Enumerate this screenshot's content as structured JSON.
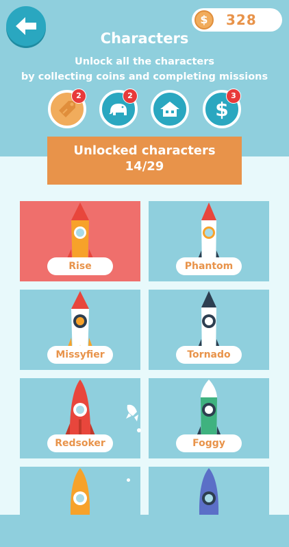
{
  "header": {
    "coins": "328",
    "coin_symbol": "$",
    "title": "Characters",
    "subtitle_line1": "Unlock all the characters",
    "subtitle_line2": "by collecting coins and completing missions"
  },
  "missions": [
    {
      "icon": "tag-icon",
      "badge": "2",
      "color": "#f1ac5c"
    },
    {
      "icon": "elephant-icon",
      "badge": "2",
      "color": "#2aa7c0"
    },
    {
      "icon": "house-icon",
      "badge": "",
      "color": "#2aa7c0"
    },
    {
      "icon": "dollar-icon",
      "badge": "3",
      "color": "#2aa7c0"
    }
  ],
  "unlocked": {
    "label": "Unlocked characters",
    "count": "14/29"
  },
  "characters": [
    {
      "name": "Rise",
      "selected": true
    },
    {
      "name": "Phantom",
      "selected": false
    },
    {
      "name": "Missyfier",
      "selected": false
    },
    {
      "name": "Tornado",
      "selected": false
    },
    {
      "name": "Redsoker",
      "selected": false
    },
    {
      "name": "Foggy",
      "selected": false
    }
  ],
  "colors": {
    "sky": "#8fcfdd",
    "accent_orange": "#e8934a",
    "selected_card": "#ef6f6c",
    "button_blue": "#2aa7c0"
  }
}
